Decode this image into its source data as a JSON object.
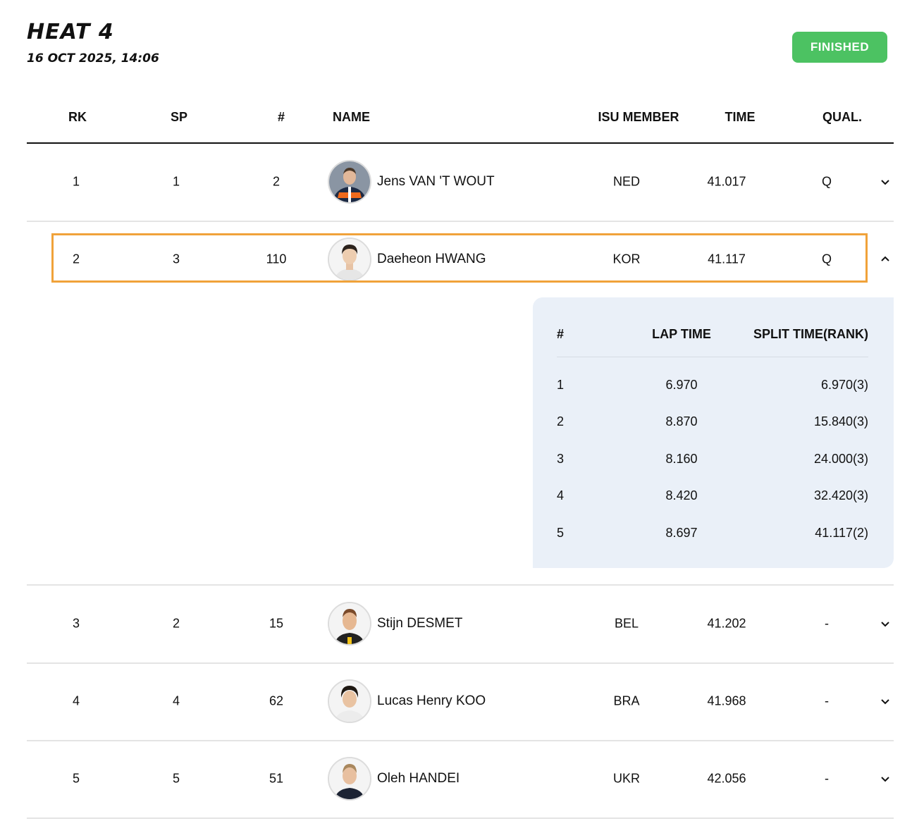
{
  "heat": {
    "title": "HEAT 4",
    "date": "16 OCT 2025, 14:06",
    "status": "FINISHED",
    "status_color": "#4cc262",
    "highlight_color": "#f0a23a"
  },
  "table": {
    "headers": {
      "rk": "RK",
      "sp": "SP",
      "num": "#",
      "name": "NAME",
      "member": "ISU MEMBER",
      "time": "TIME",
      "qual": "QUAL."
    },
    "rows": [
      {
        "rk": "1",
        "sp": "1",
        "num": "2",
        "name": "Jens VAN 'T WOUT",
        "member": "NED",
        "time": "41.017",
        "qual": "Q",
        "expanded": false
      },
      {
        "rk": "2",
        "sp": "3",
        "num": "110",
        "name": "Daeheon HWANG",
        "member": "KOR",
        "time": "41.117",
        "qual": "Q",
        "expanded": true
      },
      {
        "rk": "3",
        "sp": "2",
        "num": "15",
        "name": "Stijn DESMET",
        "member": "BEL",
        "time": "41.202",
        "qual": "-",
        "expanded": false
      },
      {
        "rk": "4",
        "sp": "4",
        "num": "62",
        "name": "Lucas Henry KOO",
        "member": "BRA",
        "time": "41.968",
        "qual": "-",
        "expanded": false
      },
      {
        "rk": "5",
        "sp": "5",
        "num": "51",
        "name": "Oleh HANDEI",
        "member": "UKR",
        "time": "42.056",
        "qual": "-",
        "expanded": false
      }
    ]
  },
  "splits": {
    "headers": {
      "lap": "#",
      "lap_time": "LAP TIME",
      "split_time": "SPLIT TIME(RANK)"
    },
    "laps": [
      {
        "lap": "1",
        "lap_time": "6.970",
        "split_time": "6.970(3)"
      },
      {
        "lap": "2",
        "lap_time": "8.870",
        "split_time": "15.840(3)"
      },
      {
        "lap": "3",
        "lap_time": "8.160",
        "split_time": "24.000(3)"
      },
      {
        "lap": "4",
        "lap_time": "8.420",
        "split_time": "32.420(3)"
      },
      {
        "lap": "5",
        "lap_time": "8.697",
        "split_time": "41.117(2)"
      }
    ]
  },
  "icons": {
    "collapsed": "chevron-down-icon",
    "expanded": "chevron-up-icon"
  }
}
